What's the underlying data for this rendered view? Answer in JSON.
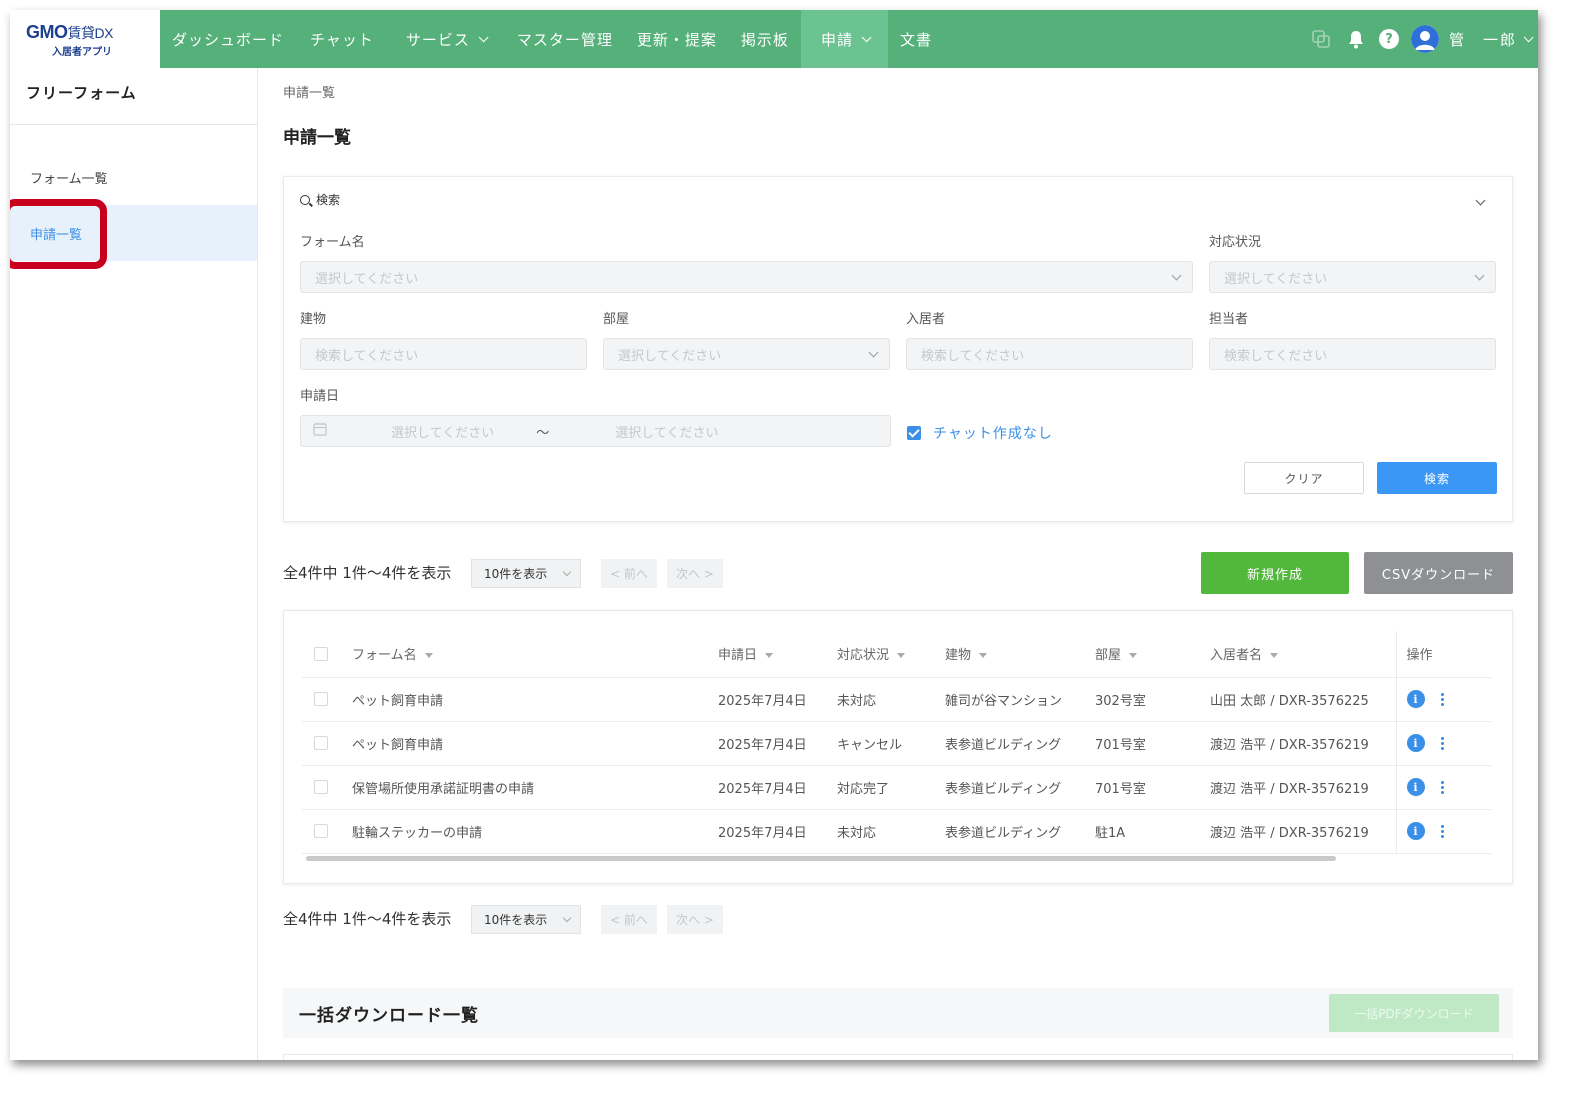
{
  "header": {
    "logo_main": "GMO",
    "logo_suffix": "賃貸DX",
    "logo_sub": "入居者アプリ",
    "nav": [
      {
        "label": "ダッシュボード",
        "dropdown": false
      },
      {
        "label": "チャット",
        "dropdown": false
      },
      {
        "label": "サービス",
        "dropdown": true
      },
      {
        "label": "マスター管理",
        "dropdown": false
      },
      {
        "label": "更新・提案",
        "dropdown": false
      },
      {
        "label": "掲示板",
        "dropdown": false
      },
      {
        "label": "申請",
        "dropdown": true,
        "active": true
      },
      {
        "label": "文書",
        "dropdown": false
      }
    ],
    "user_name": "管　一郎",
    "help_label": "?"
  },
  "sidebar": {
    "title": "フリーフォーム",
    "items": [
      {
        "label": "フォーム一覧",
        "active": false
      },
      {
        "label": "申請一覧",
        "active": true
      }
    ]
  },
  "main": {
    "breadcrumb": "申請一覧",
    "title": "申請一覧"
  },
  "search": {
    "title": "検索",
    "form_name_label": "フォーム名",
    "form_name_placeholder": "選択してください",
    "status_label": "対応状況",
    "status_placeholder": "選択してください",
    "building_label": "建物",
    "building_placeholder": "検索してください",
    "room_label": "部屋",
    "room_placeholder": "選択してください",
    "resident_label": "入居者",
    "resident_placeholder": "検索してください",
    "staff_label": "担当者",
    "staff_placeholder": "検索してください",
    "date_label": "申請日",
    "date_from_placeholder": "選択してください",
    "date_separator": "〜",
    "date_to_placeholder": "選択してください",
    "no_chat_label": "チャット作成なし",
    "no_chat_checked": true,
    "clear_label": "クリア",
    "search_label": "検索"
  },
  "pager": {
    "count_text": "全4件中 1件〜4件を表示",
    "per_page": "10件を表示",
    "prev": "< 前へ",
    "next": "次へ >"
  },
  "actions": {
    "new_label": "新規作成",
    "csv_label": "CSVダウンロード"
  },
  "table": {
    "columns": [
      "フォーム名",
      "申請日",
      "対応状況",
      "建物",
      "部屋",
      "入居者名",
      "操作"
    ],
    "rows": [
      {
        "form": "ペット飼育申請",
        "date": "2025年7月4日",
        "status": "未対応",
        "building": "雑司が谷マンション",
        "room": "302号室",
        "resident": "山田 太郎 / DXR-3576225"
      },
      {
        "form": "ペット飼育申請",
        "date": "2025年7月4日",
        "status": "キャンセル",
        "building": "表参道ビルディング",
        "room": "701号室",
        "resident": "渡辺 浩平 / DXR-3576219"
      },
      {
        "form": "保管場所使用承諾証明書の申請",
        "date": "2025年7月4日",
        "status": "対応完了",
        "building": "表参道ビルディング",
        "room": "701号室",
        "resident": "渡辺 浩平 / DXR-3576219"
      },
      {
        "form": "駐輪ステッカーの申請",
        "date": "2025年7月4日",
        "status": "未対応",
        "building": "表参道ビルディング",
        "room": "駐1A",
        "resident": "渡辺 浩平 / DXR-3576219"
      }
    ]
  },
  "bulk": {
    "title": "一括ダウンロード一覧",
    "pdf_label": "一括PDFダウンロード"
  },
  "colors": {
    "header_green": "#55b07a",
    "active_nav": "#6cc392",
    "primary_blue": "#3a97f5",
    "new_green": "#52b83b",
    "highlight_red": "#c8001e"
  }
}
